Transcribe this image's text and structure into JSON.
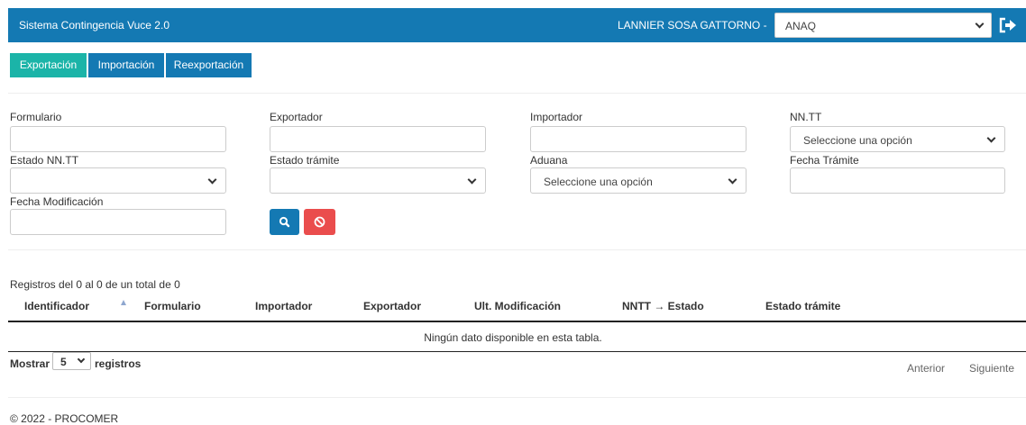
{
  "header": {
    "app_title": "Sistema Contingencia Vuce 2.0",
    "user_name": "LANNIER SOSA GATTORNO",
    "user_separator": "-",
    "company_selected": "ANAQ"
  },
  "tabs": [
    {
      "label": "Exportación",
      "active": true
    },
    {
      "label": "Importación",
      "active": false
    },
    {
      "label": "Reexportación",
      "active": false
    }
  ],
  "filters": {
    "formulario": {
      "label": "Formulario",
      "value": ""
    },
    "exportador": {
      "label": "Exportador",
      "value": ""
    },
    "importador": {
      "label": "Importador",
      "value": ""
    },
    "nntt": {
      "label": "NN.TT",
      "selected": "Seleccione una opción"
    },
    "estado_nntt": {
      "label": "Estado NN.TT",
      "selected": ""
    },
    "estado_tramite": {
      "label": "Estado trámite",
      "selected": ""
    },
    "aduana": {
      "label": "Aduana",
      "selected": "Seleccione una opción"
    },
    "fecha_tramite": {
      "label": "Fecha Trámite",
      "value": ""
    },
    "fecha_modificacion": {
      "label": "Fecha Modificación",
      "value": ""
    }
  },
  "buttons": {
    "search_icon": "search-icon",
    "clear_icon": "ban-icon"
  },
  "table": {
    "info": "Registros del 0 al 0 de un total de 0",
    "columns": [
      "Identificador",
      "Formulario",
      "Importador",
      "Exportador",
      "Ult. Modificación",
      "NNTT → Estado",
      "Estado trámite"
    ],
    "empty_message": "Ningún dato disponible en esta tabla."
  },
  "length_menu": {
    "prefix": "Mostrar",
    "value": "5",
    "suffix": "registros"
  },
  "pagination": {
    "previous": "Anterior",
    "next": "Siguiente"
  },
  "footer": {
    "text": "© 2022 - PROCOMER"
  },
  "colors": {
    "header_blue": "#1479b3",
    "active_tab_teal": "#1bb4a8",
    "clear_button_red": "#ea4d4d"
  }
}
